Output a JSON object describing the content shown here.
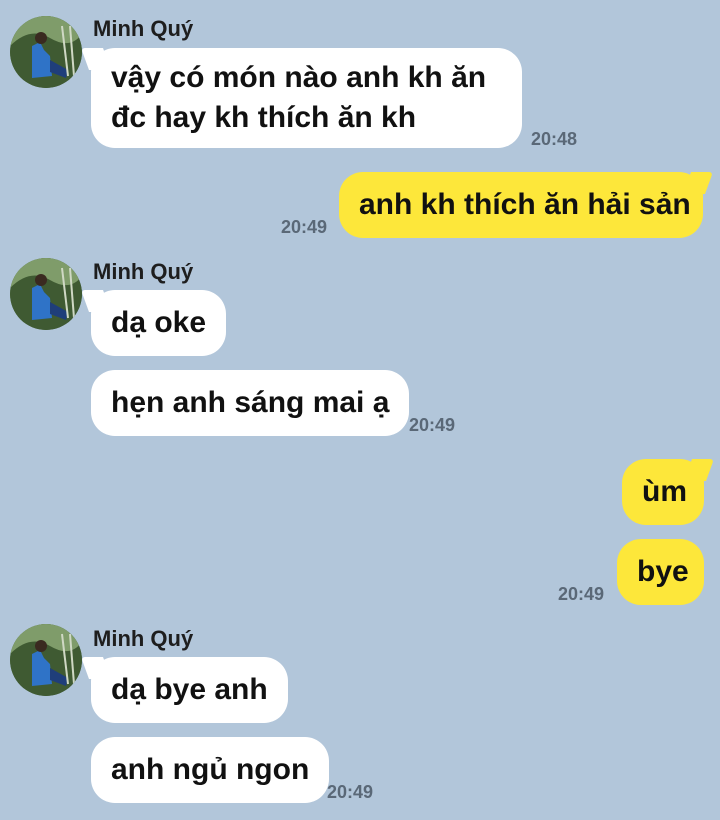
{
  "contact": {
    "name": "Minh Quý"
  },
  "groups": [
    {
      "sender": "Minh Quý",
      "messages": [
        "vậy có món nào anh kh ăn đc hay kh thích ăn kh"
      ],
      "time": "20:48"
    },
    {
      "sender": "me",
      "messages": [
        "anh kh thích ăn hải sản"
      ],
      "time": "20:49"
    },
    {
      "sender": "Minh Quý",
      "messages": [
        "dạ oke",
        "hẹn anh sáng mai ạ"
      ],
      "time": "20:49"
    },
    {
      "sender": "me",
      "messages": [
        "ùm",
        "bye"
      ],
      "time": "20:49"
    },
    {
      "sender": "Minh Quý",
      "messages": [
        "dạ bye anh",
        "anh ngủ ngon"
      ],
      "time": "20:49"
    }
  ],
  "colors": {
    "background": "#b2c6da",
    "incoming_bubble": "#ffffff",
    "outgoing_bubble": "#fde73a",
    "timestamp": "#5a6877"
  },
  "icons": {
    "avatar": "contact-avatar-photo"
  }
}
